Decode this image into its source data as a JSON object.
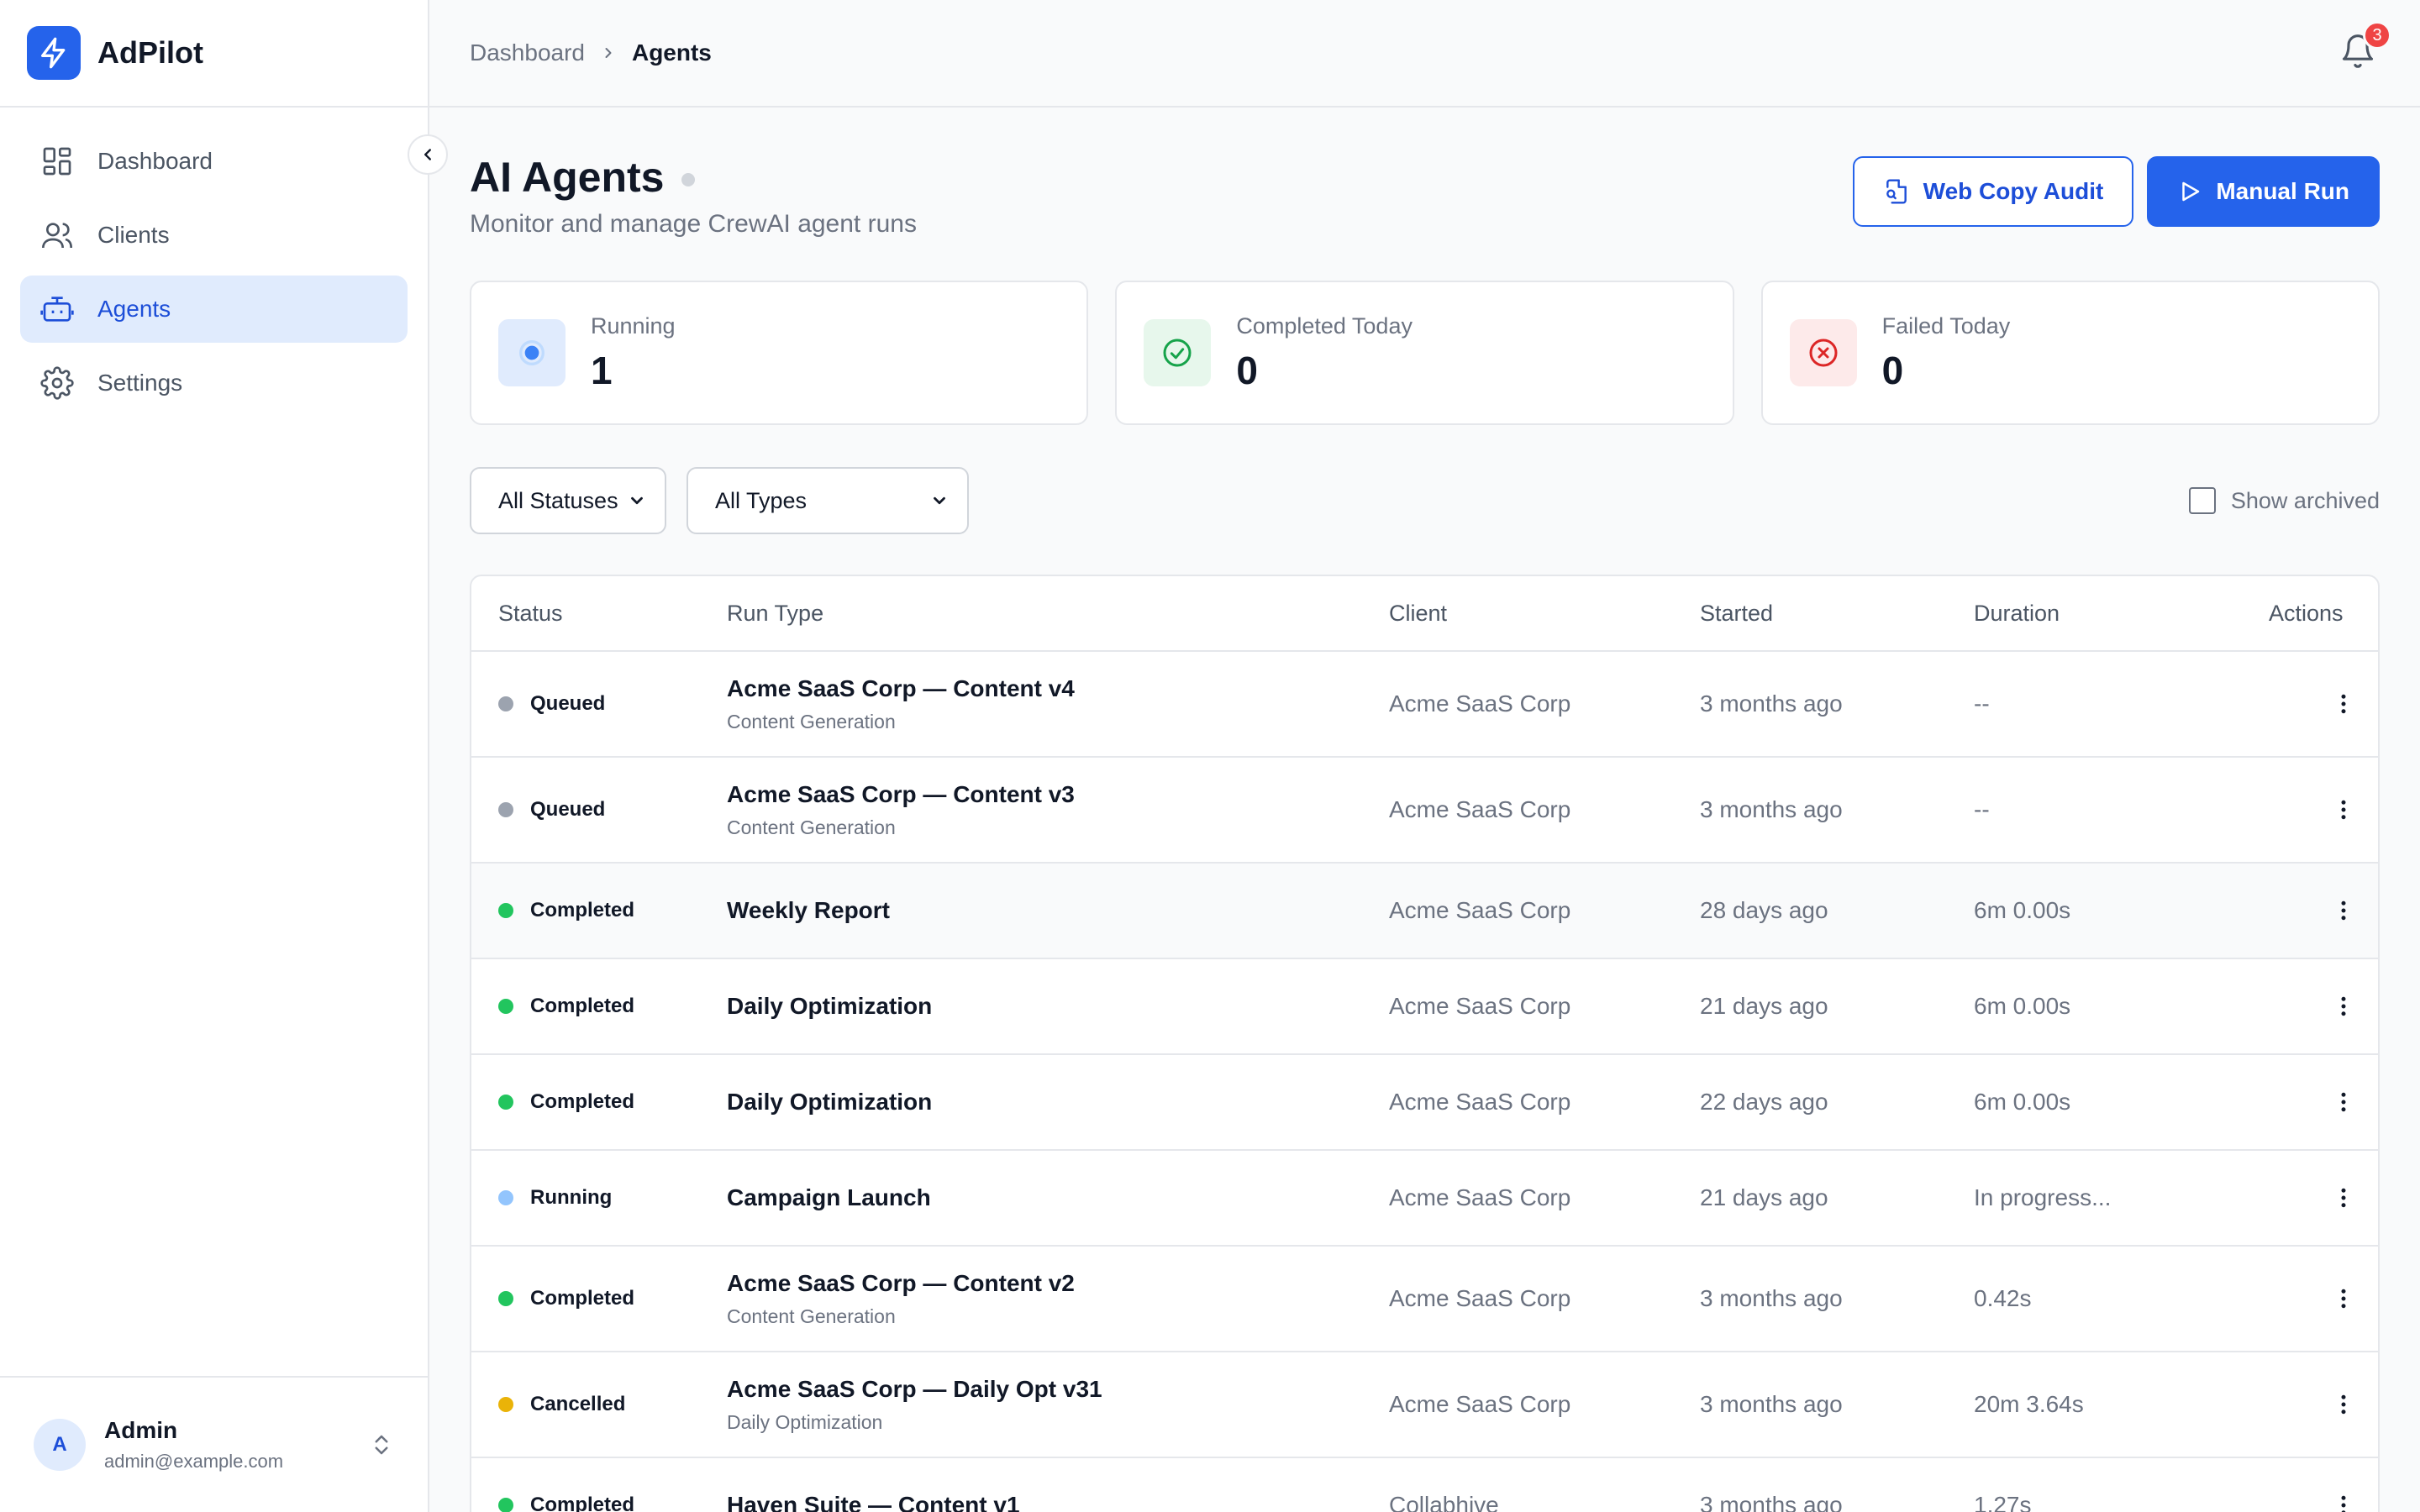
{
  "app": {
    "name": "AdPilot"
  },
  "sidebar": {
    "items": [
      {
        "label": "Dashboard",
        "icon": "dashboard-icon",
        "active": false
      },
      {
        "label": "Clients",
        "icon": "users-icon",
        "active": false
      },
      {
        "label": "Agents",
        "icon": "bot-icon",
        "active": true
      },
      {
        "label": "Settings",
        "icon": "gear-icon",
        "active": false
      }
    ],
    "user": {
      "initial": "A",
      "name": "Admin",
      "email": "admin@example.com"
    }
  },
  "breadcrumb": {
    "parent": "Dashboard",
    "current": "Agents"
  },
  "notifications": {
    "count": "3"
  },
  "page": {
    "title": "AI Agents",
    "subtitle": "Monitor and manage CrewAI agent runs",
    "web_copy_audit_label": "Web Copy Audit",
    "manual_run_label": "Manual Run"
  },
  "stats": [
    {
      "label": "Running",
      "value": "1",
      "color": "#3b82f6"
    },
    {
      "label": "Completed Today",
      "value": "0",
      "color": "#16a34a"
    },
    {
      "label": "Failed Today",
      "value": "0",
      "color": "#dc2626"
    }
  ],
  "filters": {
    "status": "All Statuses",
    "type": "All Types",
    "show_archived_label": "Show archived",
    "show_archived": false
  },
  "table": {
    "headers": {
      "status": "Status",
      "run_type": "Run Type",
      "client": "Client",
      "started": "Started",
      "duration": "Duration",
      "actions": "Actions"
    },
    "rows": [
      {
        "status": "Queued",
        "title": "Acme SaaS Corp — Content v4",
        "subtitle": "Content Generation",
        "client": "Acme SaaS Corp",
        "started": "3 months ago",
        "duration": "--"
      },
      {
        "status": "Queued",
        "title": "Acme SaaS Corp — Content v3",
        "subtitle": "Content Generation",
        "client": "Acme SaaS Corp",
        "started": "3 months ago",
        "duration": "--"
      },
      {
        "status": "Completed",
        "title": "Weekly Report",
        "subtitle": "",
        "client": "Acme SaaS Corp",
        "started": "28 days ago",
        "duration": "6m 0.00s"
      },
      {
        "status": "Completed",
        "title": "Daily Optimization",
        "subtitle": "",
        "client": "Acme SaaS Corp",
        "started": "21 days ago",
        "duration": "6m 0.00s"
      },
      {
        "status": "Completed",
        "title": "Daily Optimization",
        "subtitle": "",
        "client": "Acme SaaS Corp",
        "started": "22 days ago",
        "duration": "6m 0.00s"
      },
      {
        "status": "Running",
        "title": "Campaign Launch",
        "subtitle": "",
        "client": "Acme SaaS Corp",
        "started": "21 days ago",
        "duration": "In progress..."
      },
      {
        "status": "Completed",
        "title": "Acme SaaS Corp — Content v2",
        "subtitle": "Content Generation",
        "client": "Acme SaaS Corp",
        "started": "3 months ago",
        "duration": "0.42s"
      },
      {
        "status": "Cancelled",
        "title": "Acme SaaS Corp — Daily Opt v31",
        "subtitle": "Daily Optimization",
        "client": "Acme SaaS Corp",
        "started": "3 months ago",
        "duration": "20m 3.64s"
      },
      {
        "status": "Completed",
        "title": "Haven Suite — Content v1",
        "subtitle": "",
        "client": "Collabhive",
        "started": "3 months ago",
        "duration": "1.27s"
      }
    ]
  },
  "status_colors": {
    "Queued": "#9ca3af",
    "Completed": "#22c55e",
    "Running": "#93c5fd",
    "Cancelled": "#eab308"
  }
}
